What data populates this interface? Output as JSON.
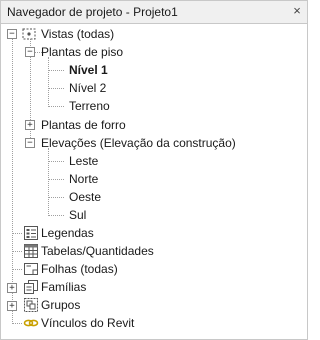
{
  "window": {
    "title": "Navegador de projeto - Projeto1",
    "close_glyph": "×"
  },
  "tree": {
    "views": {
      "toggle": "−",
      "label": "Vistas (todas)",
      "floor_plans": {
        "toggle": "−",
        "label": "Plantas de piso",
        "items": [
          "Nível 1",
          "Nível 2",
          "Terreno"
        ],
        "active_item": "Nível 1"
      },
      "ceiling_plans": {
        "toggle": "+",
        "label": "Plantas de forro"
      },
      "elevations": {
        "toggle": "−",
        "label": "Elevações (Elevação da construção)",
        "items": [
          "Leste",
          "Norte",
          "Oeste",
          "Sul"
        ]
      }
    },
    "legends": {
      "label": "Legendas",
      "icon": "legend-icon"
    },
    "schedules": {
      "label": "Tabelas/Quantidades",
      "icon": "schedule-icon"
    },
    "sheets": {
      "label": "Folhas (todas)",
      "icon": "sheet-icon"
    },
    "families": {
      "toggle": "+",
      "label": "Famílias",
      "icon": "family-icon"
    },
    "groups": {
      "toggle": "+",
      "label": "Grupos",
      "icon": "group-icon"
    },
    "links": {
      "label": "Vínculos do Revit",
      "icon": "revit-link-icon"
    }
  }
}
